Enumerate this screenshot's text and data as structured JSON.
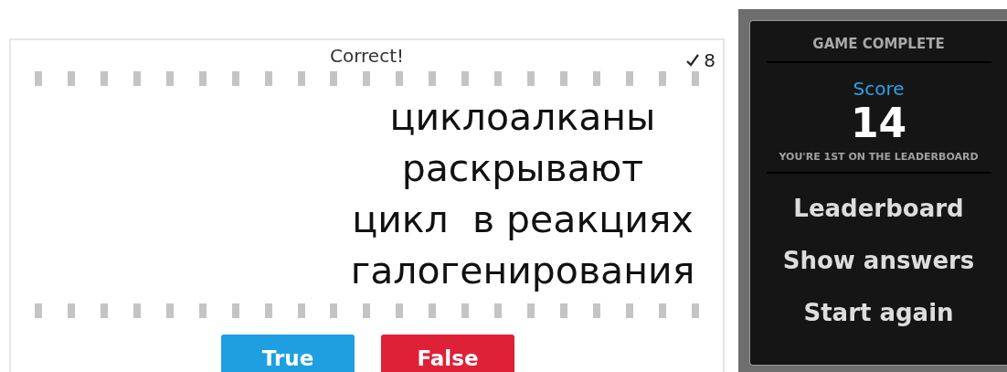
{
  "quiz": {
    "feedback": "Correct!",
    "correct_count": "8",
    "statement_lines": [
      "циклоалканы",
      "раскрывают",
      "цикл  в реакциях",
      "галогенирования"
    ],
    "answers": [
      {
        "label": "True",
        "kind": "true"
      },
      {
        "label": "False",
        "kind": "false"
      }
    ]
  },
  "results": {
    "title": "GAME COMPLETE",
    "score_label": "Score",
    "score": "14",
    "rank_note": "YOU'RE 1ST ON THE LEADERBOARD",
    "links": [
      "Leaderboard",
      "Show answers",
      "Start again"
    ]
  }
}
